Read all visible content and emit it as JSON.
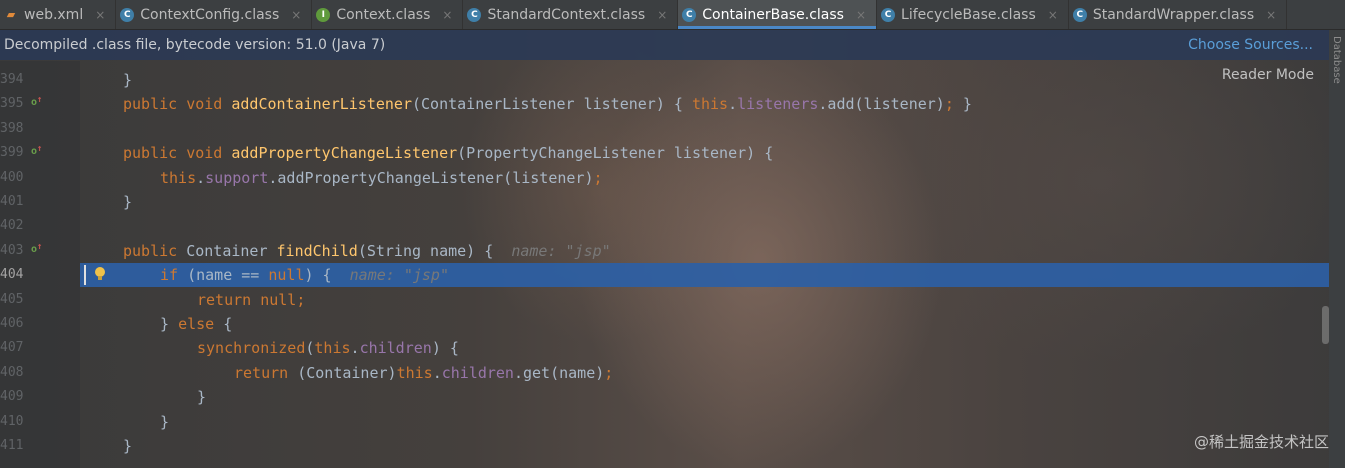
{
  "tabs": [
    {
      "label": "web.xml",
      "icon": "xml-file-icon",
      "active": false
    },
    {
      "label": "ContextConfig.class",
      "icon": "class-file-icon",
      "active": false
    },
    {
      "label": "Context.class",
      "icon": "interface-file-icon",
      "active": false
    },
    {
      "label": "StandardContext.class",
      "icon": "class-file-icon",
      "active": false
    },
    {
      "label": "ContainerBase.class",
      "icon": "class-file-icon",
      "active": true
    },
    {
      "label": "LifecycleBase.class",
      "icon": "class-file-icon",
      "active": false
    },
    {
      "label": "StandardWrapper.class",
      "icon": "class-file-icon",
      "active": false
    }
  ],
  "banner": {
    "text": "Decompiled .class file, bytecode version: 51.0 (Java 7)",
    "action": "Choose Sources..."
  },
  "reader_mode": "Reader Mode",
  "right_panel_label": "Database",
  "watermark": "@稀土掘金技术社区",
  "editor": {
    "lines": [
      {
        "num": "394",
        "tokens": [
          {
            "t": "}",
            "c": "plain"
          }
        ],
        "indent": 1
      },
      {
        "num": "395",
        "override": true,
        "tokens": [
          {
            "t": "public ",
            "c": "kw"
          },
          {
            "t": "void ",
            "c": "kw"
          },
          {
            "t": "addContainerListener",
            "c": "fn"
          },
          {
            "t": "(ContainerListener listener) { ",
            "c": "plain"
          },
          {
            "t": "this",
            "c": "kw"
          },
          {
            "t": ".",
            "c": "plain"
          },
          {
            "t": "listeners",
            "c": "fld"
          },
          {
            "t": ".add(listener)",
            "c": "plain"
          },
          {
            "t": "; ",
            "c": "kw"
          },
          {
            "t": "}",
            "c": "plain"
          }
        ],
        "indent": 1
      },
      {
        "num": "398",
        "tokens": [],
        "indent": 1
      },
      {
        "num": "399",
        "override": true,
        "tokens": [
          {
            "t": "public ",
            "c": "kw"
          },
          {
            "t": "void ",
            "c": "kw"
          },
          {
            "t": "addPropertyChangeListener",
            "c": "fn"
          },
          {
            "t": "(PropertyChangeListener listener) {",
            "c": "plain"
          }
        ],
        "indent": 1
      },
      {
        "num": "400",
        "tokens": [
          {
            "t": "this",
            "c": "kw"
          },
          {
            "t": ".",
            "c": "plain"
          },
          {
            "t": "support",
            "c": "fld"
          },
          {
            "t": ".addPropertyChangeListener(listener)",
            "c": "plain"
          },
          {
            "t": ";",
            "c": "kw"
          }
        ],
        "indent": 2
      },
      {
        "num": "401",
        "tokens": [
          {
            "t": "}",
            "c": "plain"
          }
        ],
        "indent": 1
      },
      {
        "num": "402",
        "tokens": [],
        "indent": 1
      },
      {
        "num": "403",
        "override": true,
        "tokens": [
          {
            "t": "public ",
            "c": "kw"
          },
          {
            "t": "Container ",
            "c": "plain"
          },
          {
            "t": "findChild",
            "c": "fn"
          },
          {
            "t": "(String name) {  ",
            "c": "plain"
          },
          {
            "t": "name: \"jsp\"",
            "c": "hint"
          }
        ],
        "indent": 1
      },
      {
        "num": "404",
        "current": true,
        "tokens": [
          {
            "t": "if ",
            "c": "kw"
          },
          {
            "t": "(name == ",
            "c": "plain"
          },
          {
            "t": "null",
            "c": "kw"
          },
          {
            "t": ") {  ",
            "c": "plain"
          },
          {
            "t": "name: \"jsp\"",
            "c": "hint"
          }
        ],
        "indent": 2
      },
      {
        "num": "405",
        "tokens": [
          {
            "t": "return ",
            "c": "kw"
          },
          {
            "t": "null",
            "c": "kw"
          },
          {
            "t": ";",
            "c": "kw"
          }
        ],
        "indent": 3
      },
      {
        "num": "406",
        "tokens": [
          {
            "t": "} ",
            "c": "plain"
          },
          {
            "t": "else ",
            "c": "kw"
          },
          {
            "t": "{",
            "c": "plain"
          }
        ],
        "indent": 2
      },
      {
        "num": "407",
        "tokens": [
          {
            "t": "synchronized",
            "c": "kw"
          },
          {
            "t": "(",
            "c": "plain"
          },
          {
            "t": "this",
            "c": "kw"
          },
          {
            "t": ".",
            "c": "plain"
          },
          {
            "t": "children",
            "c": "fld"
          },
          {
            "t": ") {",
            "c": "plain"
          }
        ],
        "indent": 3
      },
      {
        "num": "408",
        "tokens": [
          {
            "t": "return ",
            "c": "kw"
          },
          {
            "t": "(Container)",
            "c": "plain"
          },
          {
            "t": "this",
            "c": "kw"
          },
          {
            "t": ".",
            "c": "plain"
          },
          {
            "t": "children",
            "c": "fld"
          },
          {
            "t": ".get(name)",
            "c": "plain"
          },
          {
            "t": ";",
            "c": "kw"
          }
        ],
        "indent": 4
      },
      {
        "num": "409",
        "tokens": [
          {
            "t": "}",
            "c": "plain"
          }
        ],
        "indent": 3
      },
      {
        "num": "410",
        "tokens": [
          {
            "t": "}",
            "c": "plain"
          }
        ],
        "indent": 2
      },
      {
        "num": "411",
        "tokens": [
          {
            "t": "}",
            "c": "plain"
          }
        ],
        "indent": 1
      }
    ]
  }
}
